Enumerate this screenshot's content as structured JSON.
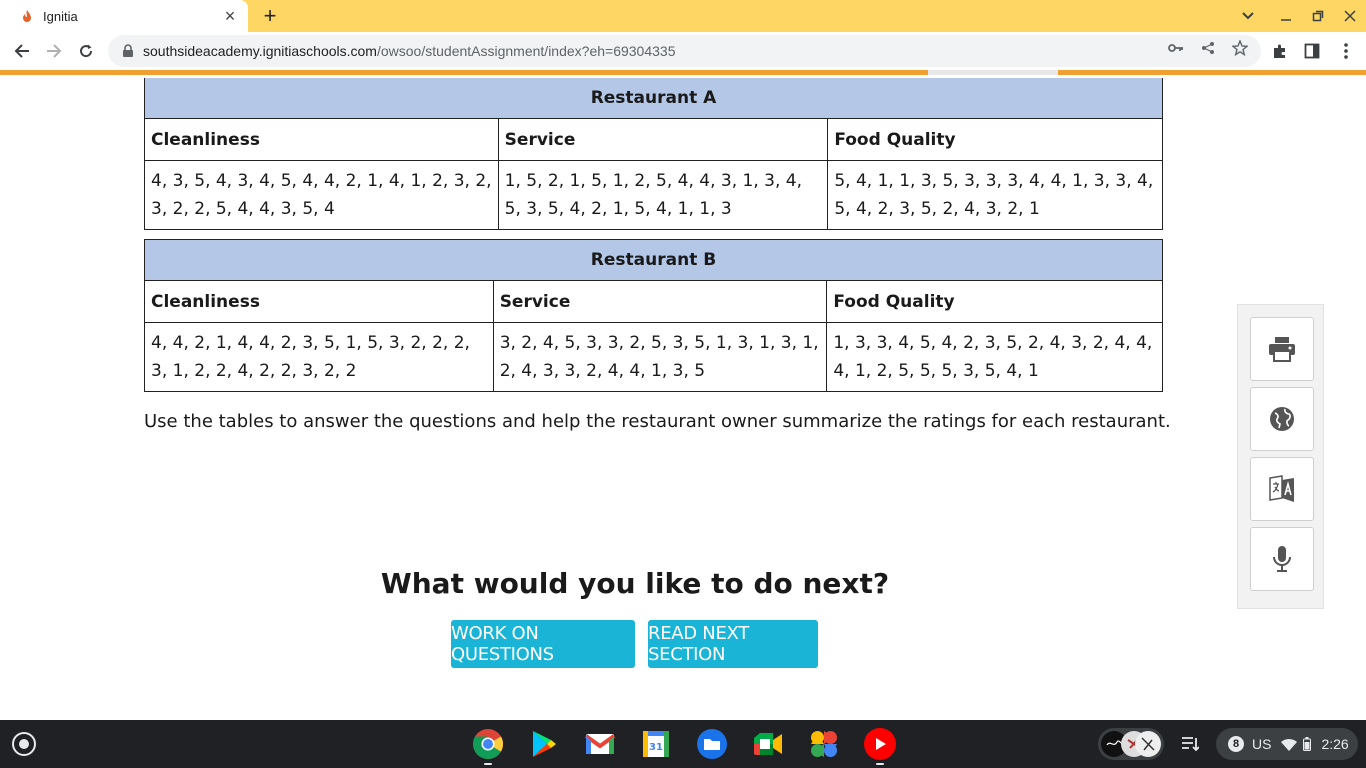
{
  "browser": {
    "tab_title": "Ignitia",
    "url_host": "southsideacademy.ignitiaschools.com",
    "url_path": "/owsoo/studentAssignment/index?eh=69304335"
  },
  "tables": {
    "a": {
      "title": "Restaurant A",
      "headers": [
        "Cleanliness",
        "Service",
        "Food Quality"
      ],
      "cells": [
        "4, 3, 5, 4, 3, 4, 5, 4, 4, 2, 1, 4, 1, 2, 3, 2, 3, 2, 2, 5, 4, 4, 3, 5, 4",
        "1, 5, 2, 1, 5, 1, 2, 5, 4, 4, 3, 1, 3, 4, 5, 3, 5, 4, 2, 1, 5, 4, 1, 1, 3",
        "5, 4, 1, 1, 3, 5, 3, 3, 3, 4, 4, 1, 3, 3, 4, 5, 4, 2, 3, 5, 2, 4, 3, 2, 1"
      ]
    },
    "b": {
      "title": "Restaurant B",
      "headers": [
        "Cleanliness",
        "Service",
        "Food Quality"
      ],
      "cells": [
        "4, 4, 2, 1, 4, 4, 2, 3, 5, 1, 5, 3, 2, 2, 2, 3, 1, 2, 2, 4, 2, 2, 3, 2, 2",
        "3, 2, 4, 5, 3, 3, 2, 5, 3, 5, 1, 3, 1, 3, 1, 2, 4, 3, 3, 2, 4, 4, 1, 3, 5",
        "1, 3, 3, 4, 5, 4, 2, 3, 5, 2, 4, 3, 2, 4, 4, 4, 1, 2, 5, 5, 5, 3, 5, 4, 1"
      ]
    }
  },
  "instructions": "Use the tables to answer the questions and help the restaurant owner summarize the ratings for each restaurant.",
  "next": {
    "heading": "What would you like to do next?",
    "work_button": "WORK ON QUESTIONS",
    "read_button": "READ NEXT SECTION"
  },
  "shelf": {
    "notification_count": "8",
    "keyboard": "US",
    "time": "2:26"
  },
  "colors": {
    "tabstrip": "#fdd663",
    "table_header": "#b4c7e7",
    "button": "#1ab4d7",
    "progress": "#f0a030",
    "shelf": "#202124"
  }
}
